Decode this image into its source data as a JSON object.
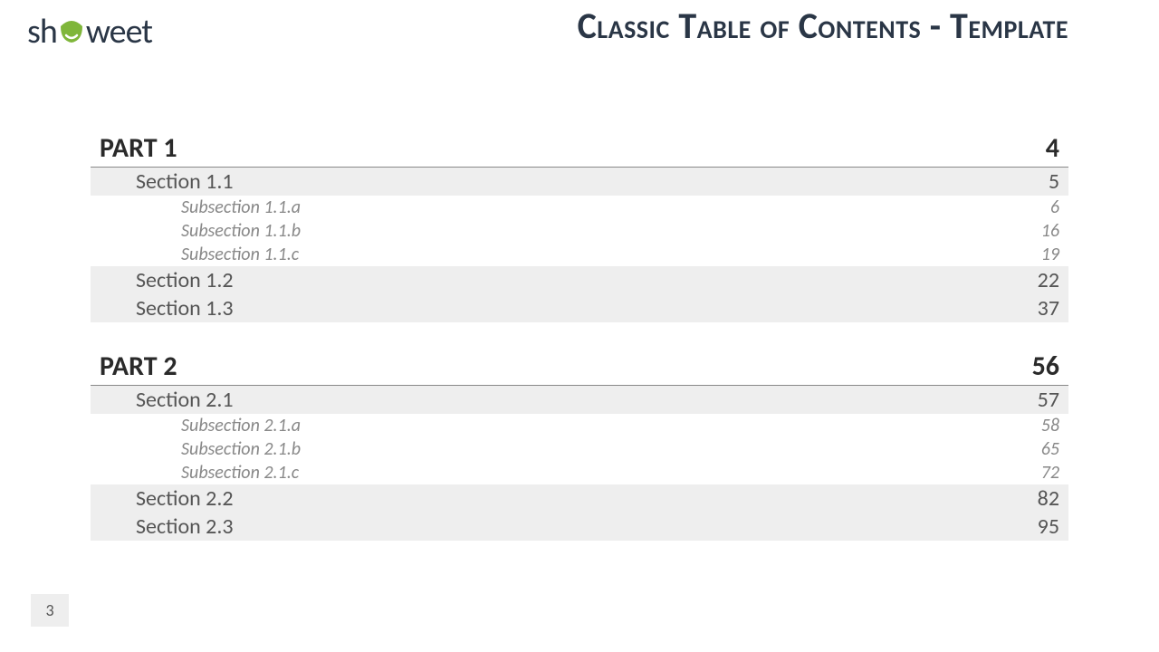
{
  "brand": {
    "pre": "sh",
    "post": "weet"
  },
  "title": "Classic Table of Contents - Template",
  "parts": [
    {
      "label": "PART 1",
      "page": "4",
      "sections": [
        {
          "label": "Section 1.1",
          "page": "5",
          "subs": [
            {
              "label": "Subsection 1.1.a",
              "page": "6"
            },
            {
              "label": "Subsection 1.1.b",
              "page": "16"
            },
            {
              "label": "Subsection 1.1.c",
              "page": "19"
            }
          ]
        },
        {
          "label": "Section 1.2",
          "page": "22",
          "subs": []
        },
        {
          "label": "Section 1.3",
          "page": "37",
          "subs": []
        }
      ]
    },
    {
      "label": "PART 2",
      "page": "56",
      "sections": [
        {
          "label": "Section 2.1",
          "page": "57",
          "subs": [
            {
              "label": "Subsection 2.1.a",
              "page": "58"
            },
            {
              "label": "Subsection 2.1.b",
              "page": "65"
            },
            {
              "label": "Subsection 2.1.c",
              "page": "72"
            }
          ]
        },
        {
          "label": "Section 2.2",
          "page": "82",
          "subs": []
        },
        {
          "label": "Section 2.3",
          "page": "95",
          "subs": []
        }
      ]
    }
  ],
  "slide_number": "3"
}
